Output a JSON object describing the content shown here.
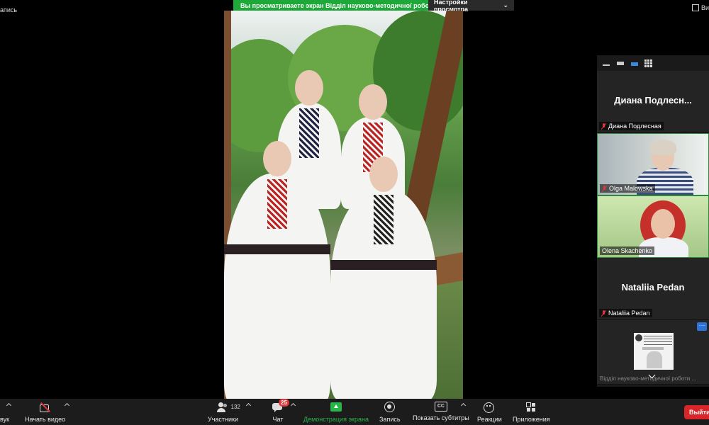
{
  "top": {
    "recording_label": "апись",
    "view_label": "Ви",
    "share_banner": {
      "text": "Вы просматриваете экран Відділ науково-методичної робо...",
      "settings_label": "Настройки просмотра"
    }
  },
  "panel": {
    "participants": [
      {
        "big_name": "Диана  Подлесн...",
        "name_tag": "Диана Подлесная",
        "muted": true,
        "video": false
      },
      {
        "name_tag": "Olga Malowska",
        "muted": true,
        "video": true
      },
      {
        "name_tag": "Olena Skachenko",
        "muted": false,
        "video": true
      },
      {
        "big_name": "Nataliia Pedan",
        "name_tag": "Nataliia Pedan",
        "muted": true,
        "video": false
      }
    ],
    "shared_thumb": {
      "more_label": "···",
      "caption": "Відділ науково-методичної роботи ..."
    }
  },
  "toolbar": {
    "audio_label": "вук",
    "video_label": "Начать видео",
    "participants_label": "Участники",
    "participants_count": "132",
    "chat_label": "Чат",
    "chat_badge": "25",
    "share_label": "Демонстрация экрана",
    "record_label": "Запись",
    "cc_icon_text": "CC",
    "subtitles_label": "Показать субтитры",
    "reactions_label": "Реакции",
    "apps_label": "Приложения",
    "leave_label": "Выйти"
  },
  "colors": {
    "share_green": "#27b548",
    "banner_green": "#1fa83a",
    "leave_red": "#d8252a",
    "badge_red": "#e0363a",
    "speaker_border": "#2c8b3a"
  }
}
